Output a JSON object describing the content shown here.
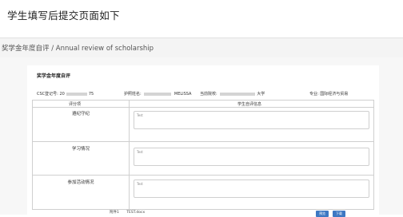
{
  "caption": "学生填写后提交页面如下",
  "header": {
    "title": "奖学金年度自评 / Annual review of scholarship"
  },
  "form": {
    "title": "奖学金年度自评",
    "info": {
      "csc_label": "CSC登记号:",
      "csc_prefix": "20",
      "csc_suffix": "75",
      "passport_label": "护照姓名:",
      "passport_suffix": "MELISSA",
      "school_label": "当前院校:",
      "school_suffix": "大学",
      "major_label": "专业:",
      "major_value": "国际经济与贸易"
    },
    "table": {
      "col_header_left": "评分项",
      "col_header_right": "学生自评信息",
      "rows": [
        {
          "label": "遵纪守纪",
          "text": "Test"
        },
        {
          "label": "学习情况",
          "text": "Test"
        },
        {
          "label": "参加活动情况",
          "text": "Test"
        }
      ]
    },
    "attachment": {
      "label": "附件1",
      "file": "TEST.docx"
    },
    "buttons": {
      "view": "预览",
      "download": "下载"
    }
  }
}
